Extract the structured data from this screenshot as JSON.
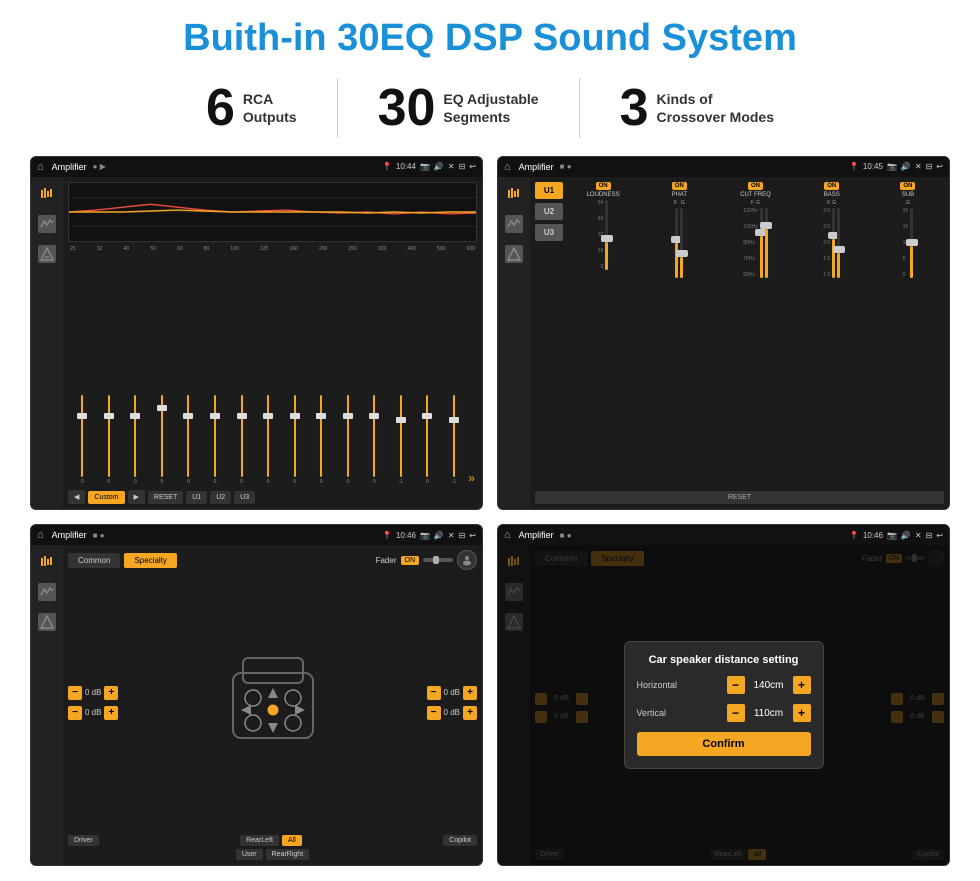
{
  "title": "Buith-in 30EQ DSP Sound System",
  "stats": [
    {
      "number": "6",
      "label": "RCA\nOutputs"
    },
    {
      "number": "30",
      "label": "EQ Adjustable\nSegments"
    },
    {
      "number": "3",
      "label": "Kinds of\nCrossover Modes"
    }
  ],
  "screens": [
    {
      "id": "eq-screen",
      "status": {
        "time": "10:44",
        "title": "Amplifier"
      },
      "type": "eq"
    },
    {
      "id": "crossover-screen",
      "status": {
        "time": "10:45",
        "title": "Amplifier"
      },
      "type": "crossover"
    },
    {
      "id": "speaker-screen",
      "status": {
        "time": "10:46",
        "title": "Amplifier"
      },
      "type": "speaker"
    },
    {
      "id": "dialog-screen",
      "status": {
        "time": "10:46",
        "title": "Amplifier"
      },
      "type": "speaker-dialog"
    }
  ],
  "eq": {
    "freqs": [
      "25",
      "32",
      "40",
      "50",
      "63",
      "80",
      "100",
      "125",
      "160",
      "200",
      "250",
      "320",
      "400",
      "500",
      "630"
    ],
    "values": [
      "0",
      "0",
      "0",
      "5",
      "0",
      "0",
      "0",
      "0",
      "0",
      "0",
      "0",
      "0",
      "-1",
      "0",
      "-1"
    ],
    "presets": [
      "Custom",
      "RESET",
      "U1",
      "U2",
      "U3"
    ]
  },
  "crossover": {
    "channels": [
      "LOUDNESS",
      "PHAT",
      "CUT FREQ",
      "BASS",
      "SUB"
    ],
    "u_buttons": [
      "U1",
      "U2",
      "U3"
    ],
    "reset": "RESET"
  },
  "speaker": {
    "tabs": [
      "Common",
      "Specialty"
    ],
    "fader_label": "Fader",
    "fader_on": "ON",
    "labels": [
      "Driver",
      "RearLeft",
      "All",
      "Copilot",
      "User",
      "RearRight"
    ],
    "rows": [
      {
        "label": "0 dB"
      },
      {
        "label": "0 dB"
      },
      {
        "label": "0 dB"
      },
      {
        "label": "0 dB"
      }
    ]
  },
  "dialog": {
    "title": "Car speaker distance setting",
    "horizontal_label": "Horizontal",
    "horizontal_value": "140cm",
    "vertical_label": "Vertical",
    "vertical_value": "110cm",
    "confirm_label": "Confirm"
  },
  "colors": {
    "accent": "#f5a623",
    "bg_dark": "#1a1a1a",
    "text_light": "#ffffff",
    "title_blue": "#1a90d9"
  }
}
